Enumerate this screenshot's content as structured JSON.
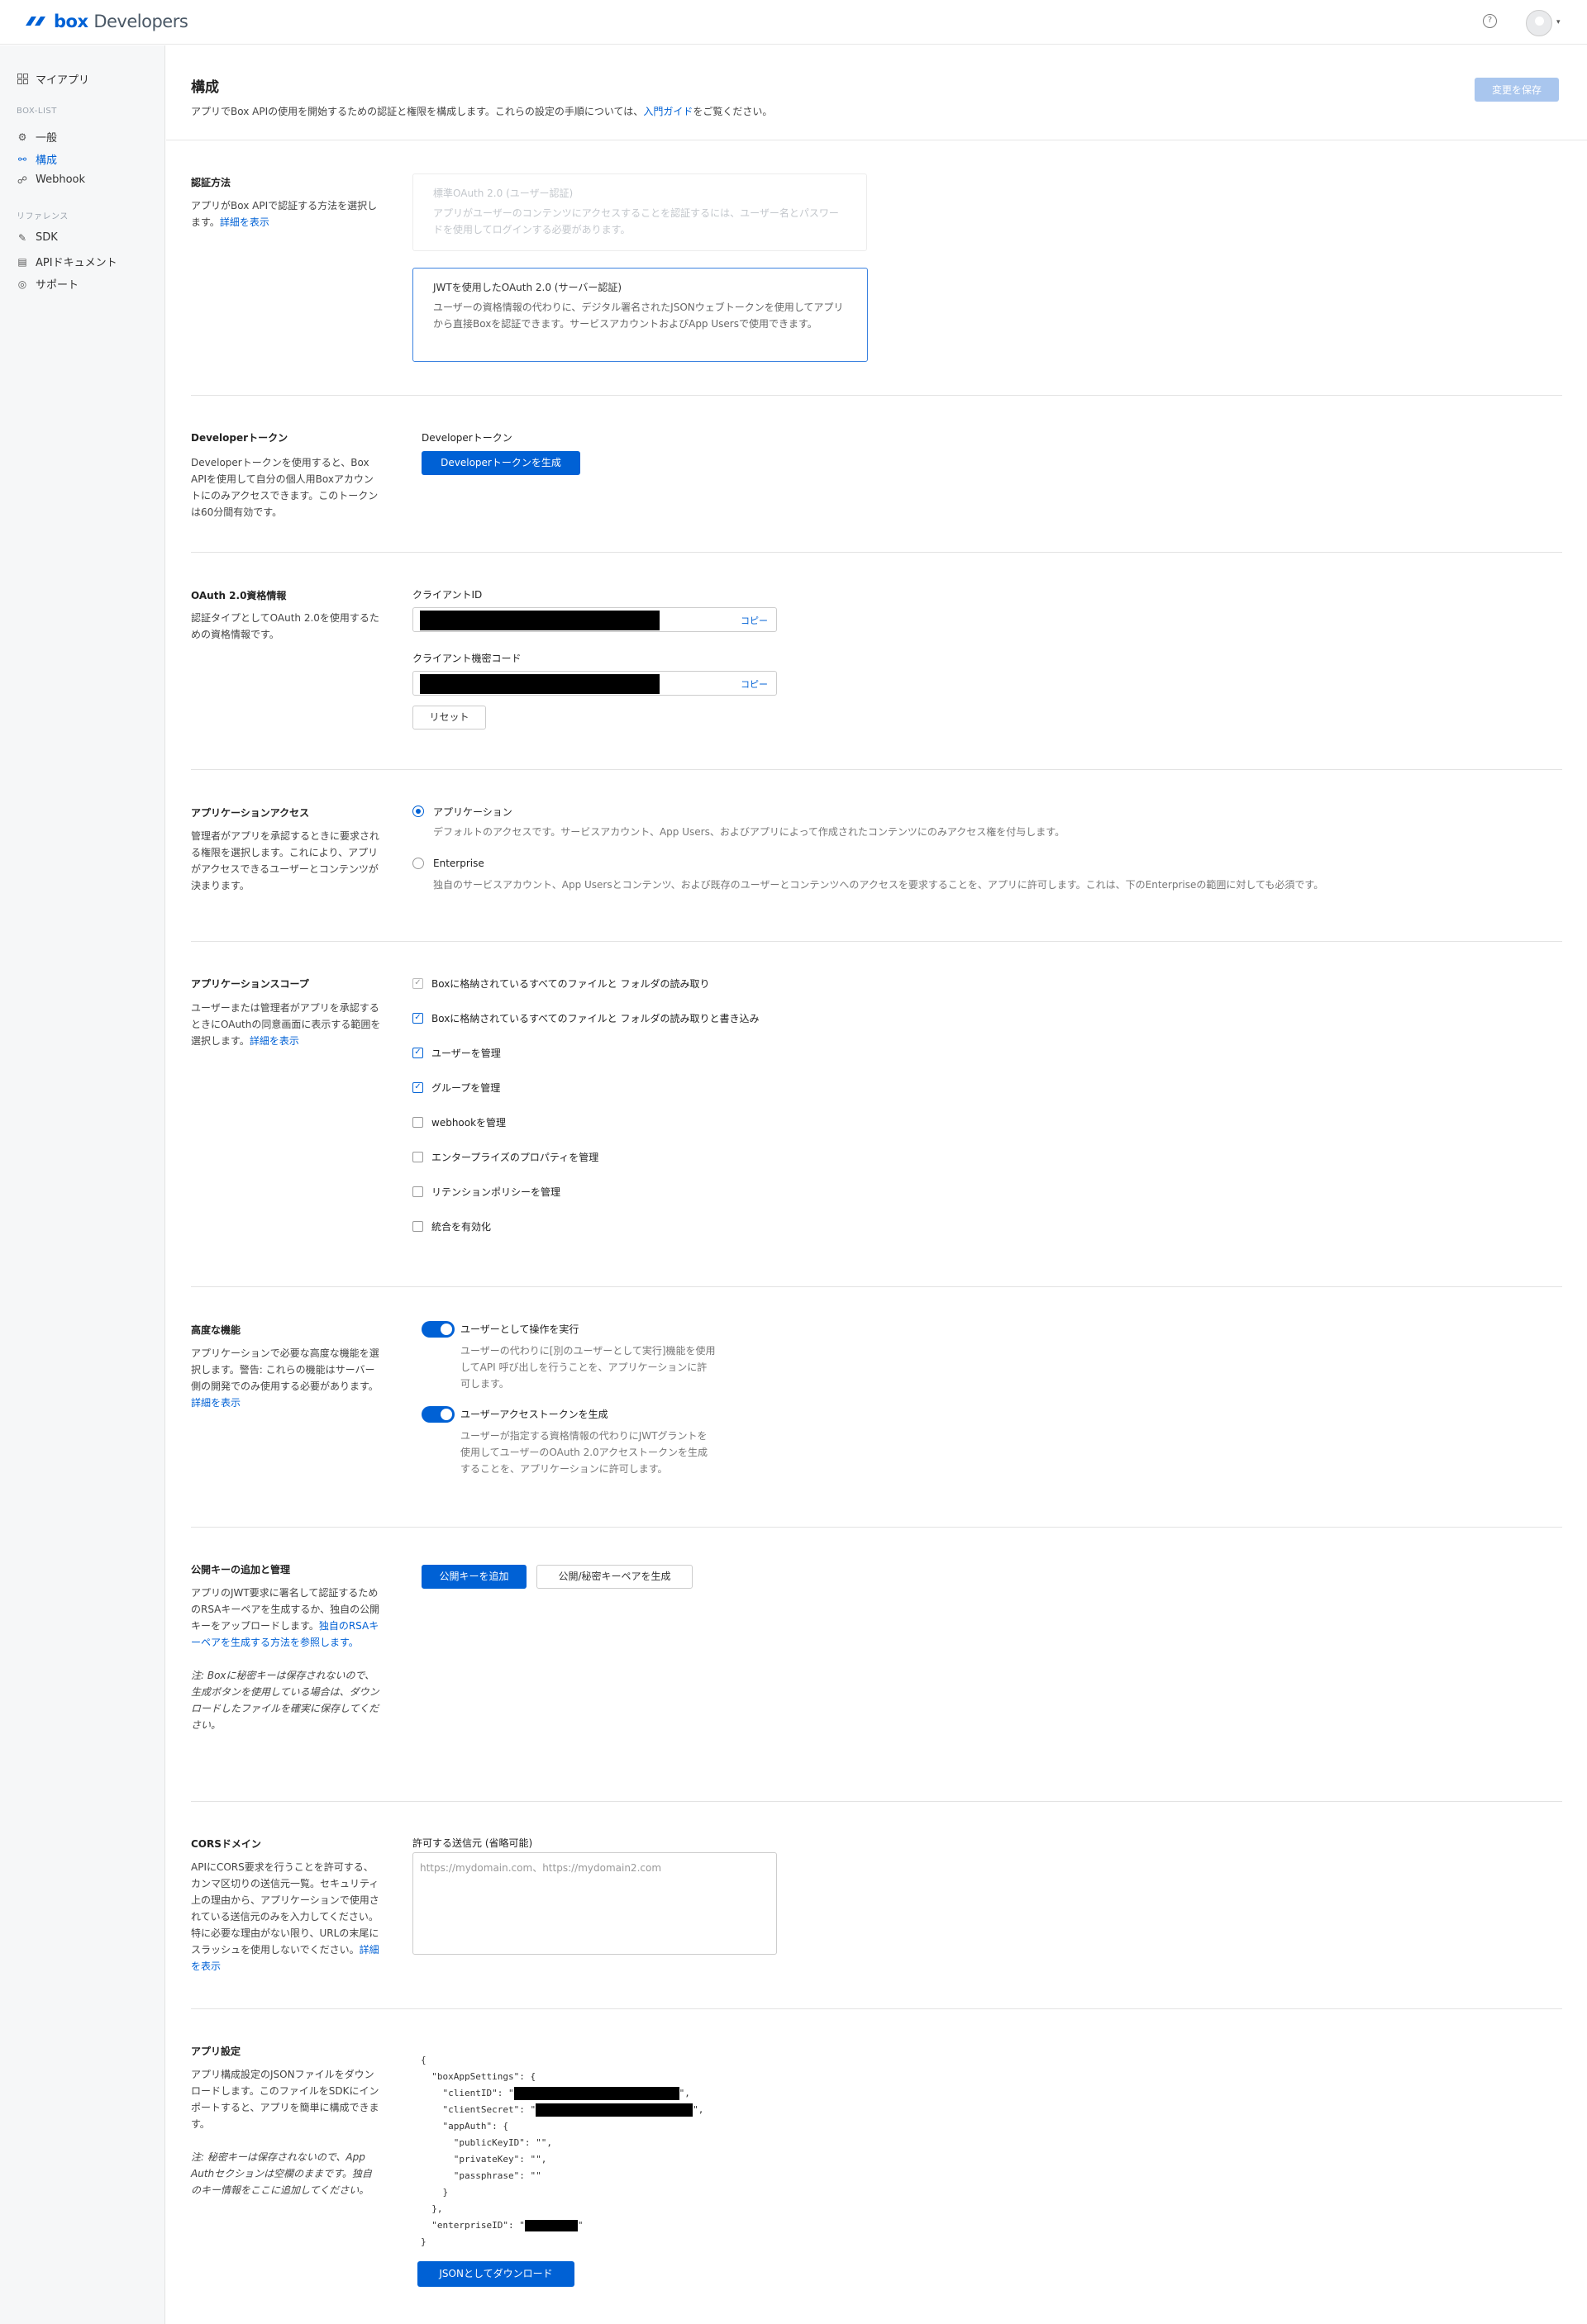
{
  "header": {
    "logo_text": "box",
    "logo_sub": "Developers",
    "help_icon": "?",
    "caret": "▾"
  },
  "sidebar": {
    "top_item": "マイアプリ",
    "section1": "BOX-LIST",
    "items1": [
      "一般",
      "構成",
      "Webhook"
    ],
    "section2": "リファレンス",
    "items2": [
      "SDK",
      "APIドキュメント",
      "サポート"
    ]
  },
  "page": {
    "title": "構成",
    "desc_pre": "アプリでBox APIの使用を開始するための認証と権限を構成します。これらの設定の手順については、",
    "desc_link": "入門ガイド",
    "desc_post": "をご覧ください。",
    "save_button": "変更を保存"
  },
  "auth": {
    "title": "認証方法",
    "desc": "アプリがBox APIで認証する方法を選択します。",
    "link": "詳細を表示",
    "opt1_title": "標準OAuth 2.0 (ユーザー認証)",
    "opt1_desc": "アプリがユーザーのコンテンツにアクセスすることを認証するには、ユーザー名とパスワードを使用してログインする必要があります。",
    "opt2_title": "JWTを使用したOAuth 2.0 (サーバー認証)",
    "opt2_desc": "ユーザーの資格情報の代わりに、デジタル署名されたJSONウェブトークンを使用してアプリから直接Boxを認証できます。サービスアカウントおよびApp Usersで使用できます。"
  },
  "devtoken": {
    "title": "Developerトークン",
    "desc": "Developerトークンを使用すると、Box APIを使用して自分の個人用Boxアカウントにのみアクセスできます。このトークンは60分間有効です。",
    "field_label": "Developerトークン",
    "button": "Developerトークンを生成"
  },
  "oauth": {
    "title": "OAuth 2.0資格情報",
    "desc": "認証タイプとしてOAuth 2.0を使用するための資格情報です。",
    "client_id_label": "クライアントID",
    "client_secret_label": "クライアント機密コード",
    "copy": "コピー",
    "reset": "リセット"
  },
  "access": {
    "title": "アプリケーションアクセス",
    "desc": "管理者がアプリを承認するときに要求される権限を選択します。これにより、アプリがアクセスできるユーザーとコンテンツが決まります。",
    "opt1_label": "アプリケーション",
    "opt1_desc": "デフォルトのアクセスです。サービスアカウント、App Users、およびアプリによって作成されたコンテンツにのみアクセス権を付与します。",
    "opt2_label": "Enterprise",
    "opt2_desc": "独自のサービスアカウント、App Usersとコンテンツ、および既存のユーザーとコンテンツへのアクセスを要求することを、アプリに許可します。これは、下のEnterpriseの範囲に対しても必須です。"
  },
  "scopes": {
    "title": "アプリケーションスコープ",
    "desc": "ユーザーまたは管理者がアプリを承認するときにOAuthの同意画面に表示する範囲を選択します。",
    "link": "詳細を表示",
    "items": [
      {
        "label": "Boxに格納されているすべてのファイルと フォルダの読み取り",
        "checked": true,
        "disabled": true
      },
      {
        "label": "Boxに格納されているすべてのファイルと フォルダの読み取りと書き込み",
        "checked": true,
        "disabled": false
      },
      {
        "label": "ユーザーを管理",
        "checked": true,
        "disabled": false
      },
      {
        "label": "グループを管理",
        "checked": true,
        "disabled": false
      },
      {
        "label": "webhookを管理",
        "checked": false,
        "disabled": false
      },
      {
        "label": "エンタープライズのプロパティを管理",
        "checked": false,
        "disabled": false
      },
      {
        "label": "リテンションポリシーを管理",
        "checked": false,
        "disabled": false
      },
      {
        "label": "統合を有効化",
        "checked": false,
        "disabled": false
      }
    ]
  },
  "advanced": {
    "title": "高度な機能",
    "desc": "アプリケーションで必要な高度な機能を選択します。警告: これらの機能はサーバー側の開発でのみ使用する必要があります。",
    "link": "詳細を表示",
    "t1_label": "ユーザーとして操作を実行",
    "t1_desc": "ユーザーの代わりに[別のユーザーとして実行]機能を使用してAPI 呼び出しを行うことを、アプリケーションに許可します。",
    "t2_label": "ユーザーアクセストークンを生成",
    "t2_desc": "ユーザーが指定する資格情報の代わりにJWTグラントを使用してユーザーのOAuth 2.0アクセストークンを生成することを、アプリケーションに許可します。"
  },
  "keys": {
    "title": "公開キーの追加と管理",
    "desc": "アプリのJWT要求に署名して認証するためのRSAキーペアを生成するか、独自の公開キーをアップロードします。",
    "link": "独自のRSAキーペアを生成する方法を参照します。",
    "note": "注: Boxに秘密キーは保存されないので、生成ボタンを使用している場合は、ダウンロードしたファイルを確実に保存してください。",
    "add_button": "公開キーを追加",
    "gen_button": "公開/秘密キーペアを生成"
  },
  "cors": {
    "title": "CORSドメイン",
    "desc": "APIにCORS要求を行うことを許可する、カンマ区切りの送信元一覧。セキュリティ上の理由から、アプリケーションで使用されている送信元のみを入力してください。特に必要な理由がない限り、URLの末尾にスラッシュを使用しないでください。",
    "link": "詳細を表示",
    "field_label": "許可する送信元 (省略可能)",
    "placeholder": "https://mydomain.com、https://mydomain2.com"
  },
  "appsettings": {
    "title": "アプリ設定",
    "desc": "アプリ構成設定のJSONファイルをダウンロードします。このファイルをSDKにインポートすると、アプリを簡単に構成できます。",
    "note": "注: 秘密キーは保存されないので、App Authセクションは空欄のままです。独自のキー情報をここに追加してください。",
    "json_lines": [
      "{",
      "  \"boxAppSettings\": {",
      "    \"clientID\": \"",
      "    \"clientSecret\": \"",
      "    \"appAuth\": {",
      "      \"publicKeyID\": \"\",",
      "      \"privateKey\": \"\",",
      "      \"passphrase\": \"\"",
      "    }",
      "  },",
      "  \"enterpriseID\": \"",
      "}"
    ],
    "download_button": "JSONとしてダウンロード"
  },
  "colors": {
    "accent": "#0061d5",
    "sidebar_bg": "#f6f7f8",
    "border": "#e3e3e3"
  }
}
